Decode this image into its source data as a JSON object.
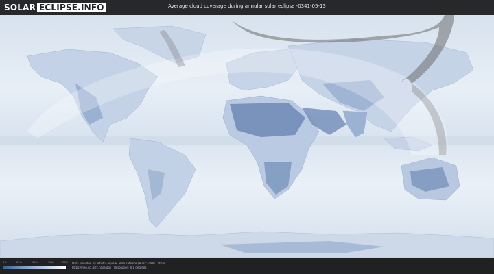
{
  "header": {
    "logo_solar": "SOLAR",
    "logo_eclipse": "ECLIPSE.INFO",
    "title": "Average cloud coverage during annular solar eclipse -0341-05-13"
  },
  "legend": {
    "ticks": [
      "0%",
      "25%",
      "50%",
      "75%",
      "100%"
    ],
    "tick_values": [
      0,
      0.25,
      0.5,
      0.75,
      1.0
    ]
  },
  "credits": {
    "line1": "Data provided by NASA's Aqua & Terra satellite (Years: 2000 - 2019)",
    "line2": "https://neo.sci.gsfc.nasa.gov | Resolution: 0.1 degrees"
  },
  "colors": {
    "header_bg": "#26282a",
    "ocean_light": "#e6edf5",
    "clear_sky": "#6d88b3",
    "eclipse_shadow": "#6e6e6e"
  }
}
